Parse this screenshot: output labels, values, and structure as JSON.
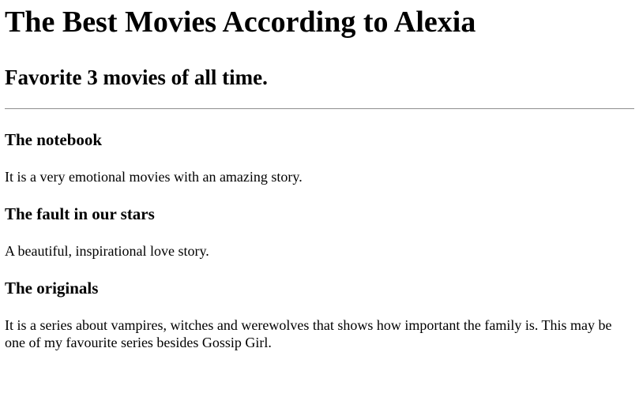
{
  "page": {
    "title": "The Best Movies According to Alexia",
    "subtitle": "Favorite 3 movies of all time."
  },
  "movies": [
    {
      "title": "The notebook",
      "description": "It is a very emotional movies with an amazing story."
    },
    {
      "title": "The fault in our stars",
      "description": "A beautiful, inspirational love story."
    },
    {
      "title": "The originals",
      "description": "It is a series about vampires, witches and werewolves that shows how important the family is. This may be one of my favourite series besides Gossip Girl."
    }
  ]
}
